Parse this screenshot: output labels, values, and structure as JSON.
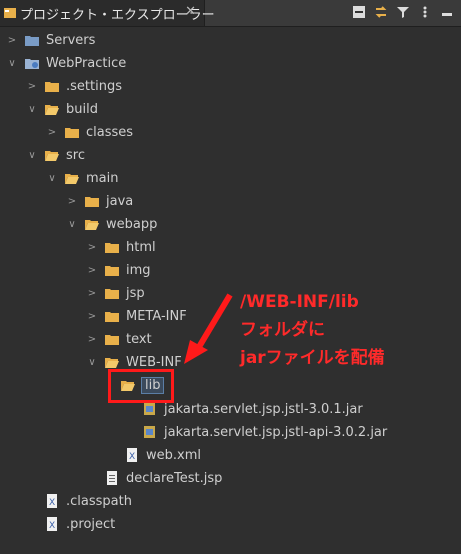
{
  "tab": {
    "title": "プロジェクト・エクスプローラー",
    "close": "✕"
  },
  "tree": {
    "servers": "Servers",
    "project": "WebPractice",
    "settings": ".settings",
    "build": "build",
    "classes": "classes",
    "src": "src",
    "main": "main",
    "java": "java",
    "webapp": "webapp",
    "html": "html",
    "img": "img",
    "jsp": "jsp",
    "meta_inf": "META-INF",
    "text": "text",
    "web_inf": "WEB-INF",
    "lib": "lib",
    "jar1": "jakarta.servlet.jsp.jstl-3.0.1.jar",
    "jar2": "jakarta.servlet.jsp.jstl-api-3.0.2.jar",
    "web_xml": "web.xml",
    "declare_test": "declareTest.jsp",
    "classpath": ".classpath",
    "dot_project": ".project"
  },
  "annotation": {
    "line1": "/WEB-INF/lib",
    "line2": "フォルダに",
    "line3": "jarファイルを配備"
  },
  "colors": {
    "annotation": "#ff2a2a",
    "folder": "#e8b04a",
    "background": "#2f2f2f"
  }
}
